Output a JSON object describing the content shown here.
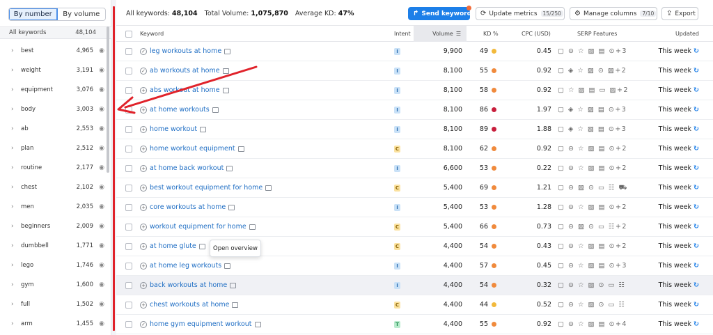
{
  "left_panel": {
    "toggle": {
      "by_number": "By number",
      "by_volume": "By volume"
    },
    "header": {
      "label": "All keywords",
      "count": "48,104"
    },
    "groups": [
      {
        "name": "best",
        "count": "4,965"
      },
      {
        "name": "weight",
        "count": "3,191"
      },
      {
        "name": "equipment",
        "count": "3,076"
      },
      {
        "name": "body",
        "count": "3,003"
      },
      {
        "name": "ab",
        "count": "2,553"
      },
      {
        "name": "plan",
        "count": "2,512"
      },
      {
        "name": "routine",
        "count": "2,177"
      },
      {
        "name": "chest",
        "count": "2,102"
      },
      {
        "name": "men",
        "count": "2,035"
      },
      {
        "name": "beginners",
        "count": "2,009"
      },
      {
        "name": "dumbbell",
        "count": "1,771"
      },
      {
        "name": "lego",
        "count": "1,746"
      },
      {
        "name": "gym",
        "count": "1,600"
      },
      {
        "name": "full",
        "count": "1,502"
      },
      {
        "name": "arm",
        "count": "1,455"
      }
    ]
  },
  "topbar": {
    "all_keywords_label": "All keywords:",
    "all_keywords_value": "48,104",
    "total_volume_label": "Total Volume:",
    "total_volume_value": "1,075,870",
    "avg_kd_label": "Average KD:",
    "avg_kd_value": "47%",
    "send_keywords": "Send keywords",
    "update_metrics": "Update metrics",
    "update_metrics_count": "15/250",
    "manage_columns": "Manage columns",
    "manage_columns_count": "7/10",
    "export": "Export"
  },
  "table": {
    "headers": {
      "keyword": "Keyword",
      "intent": "Intent",
      "volume": "Volume",
      "kd": "KD %",
      "cpc": "CPC (USD)",
      "serp": "SERP Features",
      "updated": "Updated"
    },
    "rows": [
      {
        "keyword": "leg workouts at home",
        "added": true,
        "intent": "I",
        "volume": "9,900",
        "kd": "49",
        "kd_color": "#f2b93b",
        "cpc": "0.45",
        "serp": "▢ ⊝ ☆ ▨ ▤ ⊙",
        "more": "+3",
        "updated": "This week"
      },
      {
        "keyword": "ab workouts at home",
        "added": true,
        "intent": "I",
        "volume": "8,100",
        "kd": "55",
        "kd_color": "#f08a3c",
        "cpc": "0.92",
        "serp": "▢ ◈ ☆ ▨ ⊙ ▨",
        "more": "+2",
        "updated": "This week"
      },
      {
        "keyword": "abs workout at home",
        "added": false,
        "intent": "I",
        "volume": "8,100",
        "kd": "58",
        "kd_color": "#f08a3c",
        "cpc": "0.92",
        "serp": "▢ ☆ ▨ ▤ ▭ ▨",
        "more": "+2",
        "updated": "This week"
      },
      {
        "keyword": "at home workouts",
        "added": false,
        "intent": "I",
        "volume": "8,100",
        "kd": "86",
        "kd_color": "#c81e3c",
        "cpc": "1.97",
        "serp": "▢ ◈ ☆ ▨ ▤ ⊙",
        "more": "+3",
        "updated": "This week"
      },
      {
        "keyword": "home workout",
        "added": false,
        "intent": "I",
        "volume": "8,100",
        "kd": "89",
        "kd_color": "#c81e3c",
        "cpc": "1.88",
        "serp": "▢ ◈ ☆ ▨ ▤ ⊙",
        "more": "+3",
        "updated": "This week"
      },
      {
        "keyword": "home workout equipment",
        "added": false,
        "intent": "C",
        "volume": "8,100",
        "kd": "62",
        "kd_color": "#f08a3c",
        "cpc": "0.92",
        "serp": "▢ ⊝ ☆ ▨ ▤ ⊙",
        "more": "+2",
        "updated": "This week"
      },
      {
        "keyword": "at home back workout",
        "added": false,
        "intent": "I",
        "volume": "6,600",
        "kd": "53",
        "kd_color": "#f08a3c",
        "cpc": "0.22",
        "serp": "▢ ⊝ ☆ ▨ ▤ ⊙",
        "more": "+2",
        "updated": "This week"
      },
      {
        "keyword": "best workout equipment for home",
        "added": false,
        "intent": "C",
        "volume": "5,400",
        "kd": "69",
        "kd_color": "#f08a3c",
        "cpc": "1.21",
        "serp": "▢ ⊝ ▨ ⊙ ▭ ☷ ⛟",
        "more": "",
        "updated": "This week"
      },
      {
        "keyword": "core workouts at home",
        "added": false,
        "intent": "I",
        "volume": "5,400",
        "kd": "53",
        "kd_color": "#f08a3c",
        "cpc": "1.28",
        "serp": "▢ ⊝ ☆ ▨ ▤ ⊙",
        "more": "+2",
        "updated": "This week"
      },
      {
        "keyword": "workout equipment for home",
        "added": false,
        "intent": "C",
        "volume": "5,400",
        "kd": "66",
        "kd_color": "#f08a3c",
        "cpc": "0.73",
        "serp": "▢ ⊝ ▨ ⊙ ▭ ☷",
        "more": "+2",
        "updated": "This week"
      },
      {
        "keyword": "at home glute",
        "added": false,
        "intent": "C",
        "volume": "4,400",
        "kd": "54",
        "kd_color": "#f08a3c",
        "cpc": "0.43",
        "serp": "▢ ⊝ ☆ ▨ ▤ ⊙",
        "more": "+2",
        "updated": "This week"
      },
      {
        "keyword": "at home leg workouts",
        "added": false,
        "intent": "I",
        "volume": "4,400",
        "kd": "57",
        "kd_color": "#f08a3c",
        "cpc": "0.45",
        "serp": "▢ ⊝ ☆ ▨ ▤ ⊙",
        "more": "+3",
        "updated": "This week"
      },
      {
        "keyword": "back workouts at home",
        "added": false,
        "intent": "I",
        "volume": "4,400",
        "kd": "54",
        "kd_color": "#f08a3c",
        "cpc": "0.32",
        "serp": "▢ ⊝ ☆ ▨ ⊙ ▭ ☷",
        "more": "",
        "updated": "This week"
      },
      {
        "keyword": "chest workouts at home",
        "added": false,
        "intent": "C",
        "volume": "4,400",
        "kd": "44",
        "kd_color": "#f2b93b",
        "cpc": "0.52",
        "serp": "▢ ⊝ ☆ ▨ ⊙ ▭ ☷",
        "more": "",
        "updated": "This week"
      },
      {
        "keyword": "home gym equipment workout",
        "added": true,
        "intent": "T",
        "volume": "4,400",
        "kd": "55",
        "kd_color": "#f08a3c",
        "cpc": "0.92",
        "serp": "▢ ⊝ ☆ ▨ ▤ ⊙",
        "more": "+4",
        "updated": "This week"
      }
    ]
  },
  "tooltip": {
    "text": "Open overview"
  },
  "colors": {
    "accent": "#1d7fe8",
    "annotation": "#e0222a"
  }
}
